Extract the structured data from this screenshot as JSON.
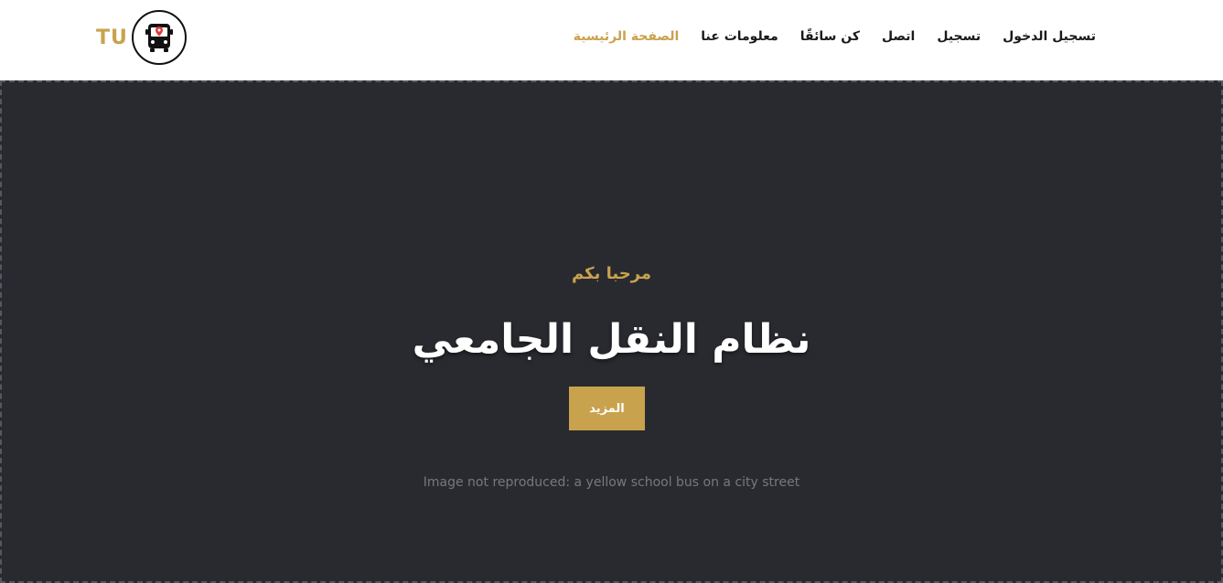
{
  "brand": {
    "logo_text": "TU",
    "accent_color": "#c9a24e",
    "icon": "bus-location-icon"
  },
  "nav": {
    "items": [
      {
        "label": "تسجيل الدخول",
        "active": false
      },
      {
        "label": "تسجيل",
        "active": false
      },
      {
        "label": "اتصل",
        "active": false
      },
      {
        "label": "كن سائقًا",
        "active": false
      },
      {
        "label": "معلومات عنا",
        "active": false
      },
      {
        "label": "الصفحة الرئيسية",
        "active": true
      }
    ]
  },
  "hero": {
    "welcome": "مرحبا بكم",
    "title": "نظام النقل الجامعي",
    "button_label": "المزيد",
    "photo_note": "Image not reproduced: a yellow school bus on a city street"
  }
}
